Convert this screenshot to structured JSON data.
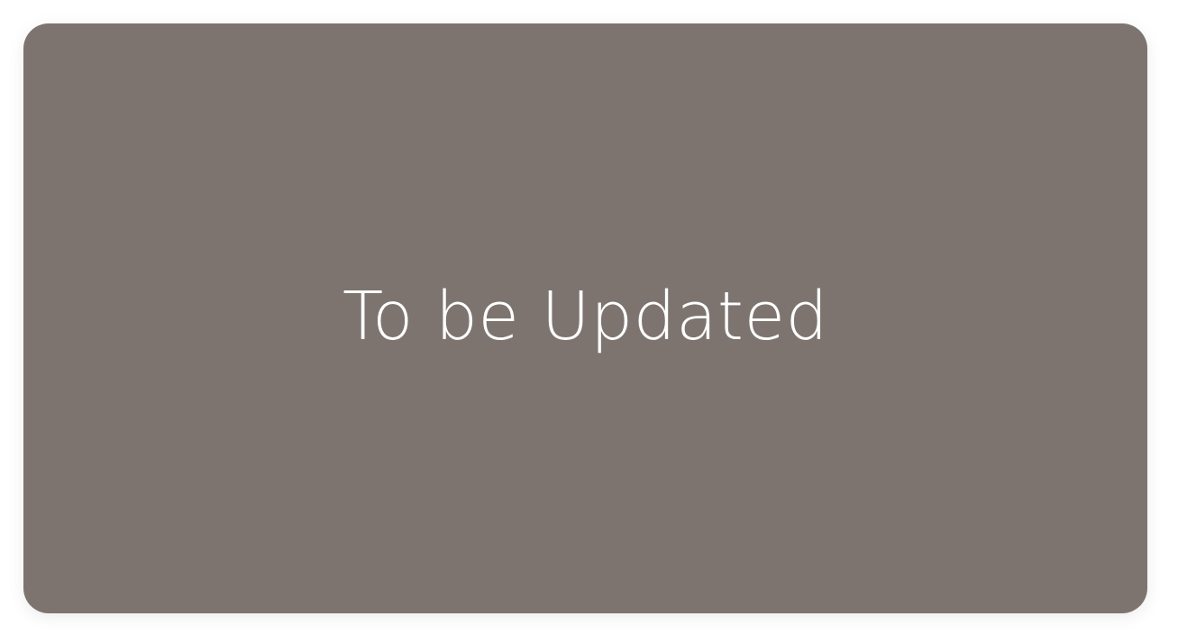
{
  "card": {
    "title": "To be Updated",
    "background_color": "#7d7470",
    "text_color": "#ffffff"
  }
}
